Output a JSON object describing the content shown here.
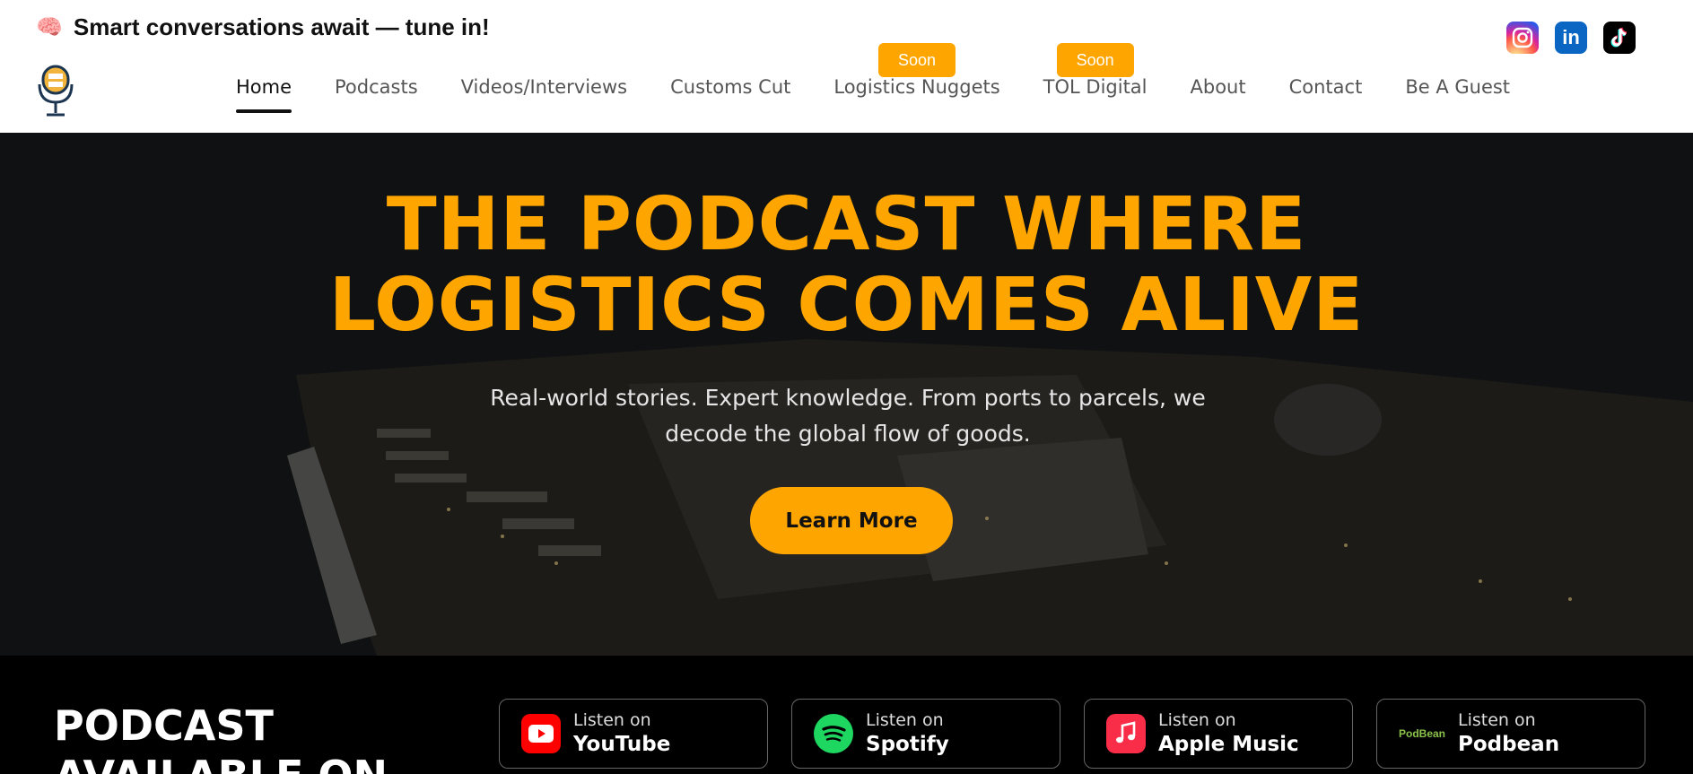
{
  "header": {
    "tagline_emoji": "🧠",
    "tagline": "Smart conversations await — tune in!",
    "nav": [
      {
        "label": "Home",
        "active": true
      },
      {
        "label": "Podcasts"
      },
      {
        "label": "Videos/Interviews"
      },
      {
        "label": "Customs Cut"
      },
      {
        "label": "Logistics Nuggets",
        "badge": "Soon"
      },
      {
        "label": "TOL Digital",
        "badge": "Soon"
      },
      {
        "label": "About"
      },
      {
        "label": "Contact"
      },
      {
        "label": "Be A Guest"
      }
    ],
    "socials": [
      "instagram-icon",
      "linkedin-icon",
      "tiktok-icon"
    ],
    "linkedin_text": "in"
  },
  "hero": {
    "title_line1": "THE PODCAST WHERE",
    "title_line2": "LOGISTICS COMES ALIVE",
    "subtitle": "Real-world stories. Expert knowledge. From ports to parcels, we decode the global flow of goods.",
    "cta": "Learn More"
  },
  "platforms": {
    "title": "PODCAST AVAILABLE ON",
    "items": [
      {
        "small": "Listen on",
        "big": "YouTube",
        "icon": "youtube-icon"
      },
      {
        "small": "Listen on",
        "big": "Spotify",
        "icon": "spotify-icon"
      },
      {
        "small": "Listen on",
        "big": "Apple Music",
        "icon": "apple-music-icon"
      },
      {
        "small": "Listen on",
        "big": "Podbean",
        "icon": "podbean-icon",
        "icon_text": "PodBean"
      }
    ]
  },
  "colors": {
    "accent": "#FFA500",
    "dark": "#000000",
    "youtube": "#FF0000",
    "spotify": "#1ED760",
    "apple_music": "#FA2D48",
    "podbean": "#8BC34A"
  }
}
